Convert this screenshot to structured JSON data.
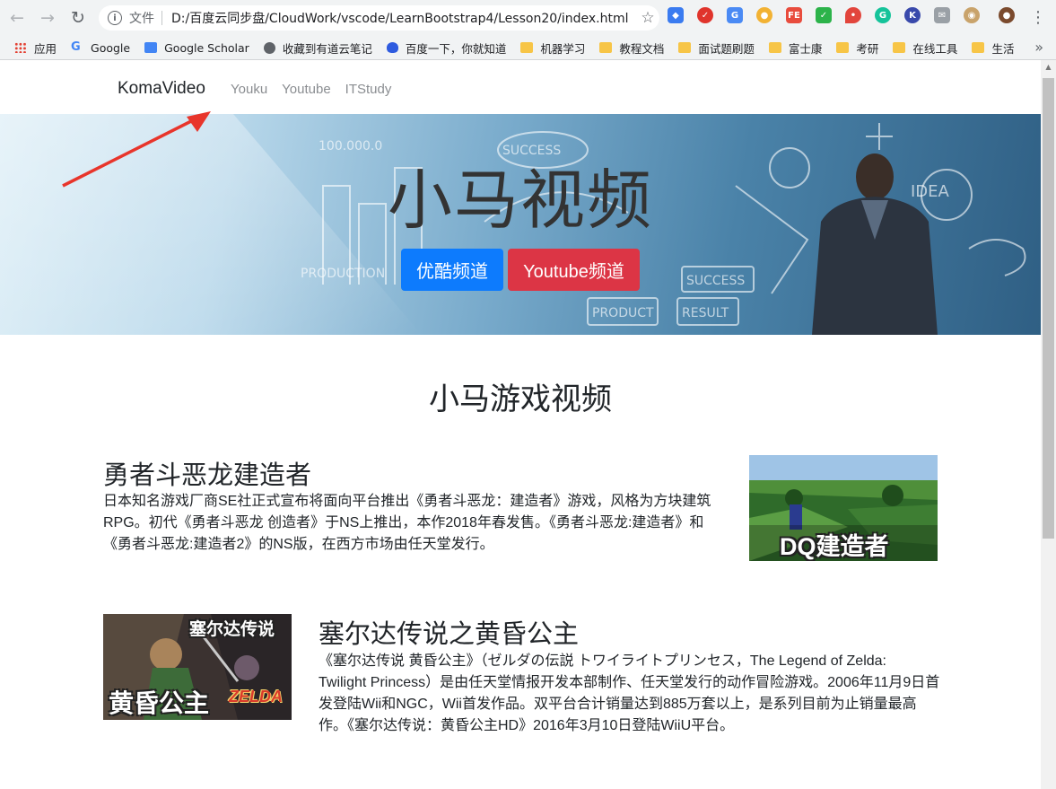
{
  "browser": {
    "url_scheme": "文件",
    "url": "D:/百度云同步盘/CloudWork/vscode/LearnBootstrap4/Lesson20/index.html",
    "bookmarks": [
      {
        "label": "应用",
        "icon": "apps-grid-icon"
      },
      {
        "label": "Google",
        "icon": "google-icon"
      },
      {
        "label": "Google Scholar",
        "icon": "scholar-icon"
      },
      {
        "label": "收藏到有道云笔记",
        "icon": "globe-icon"
      },
      {
        "label": "百度一下，你就知道",
        "icon": "baidu-paw-icon"
      },
      {
        "label": "机器学习",
        "icon": "folder-icon"
      },
      {
        "label": "教程文档",
        "icon": "folder-icon"
      },
      {
        "label": "面试题刷题",
        "icon": "folder-icon"
      },
      {
        "label": "富士康",
        "icon": "folder-icon"
      },
      {
        "label": "考研",
        "icon": "folder-icon"
      },
      {
        "label": "在线工具",
        "icon": "folder-icon"
      },
      {
        "label": "生活",
        "icon": "folder-icon"
      }
    ],
    "more_bookmarks": "»"
  },
  "page": {
    "brand": "KomaVideo",
    "nav": [
      "Youku",
      "Youtube",
      "ITStudy"
    ],
    "hero": {
      "title": "小马视频",
      "primary_button": "优酷频道",
      "danger_button": "Youtube频道"
    },
    "section_title": "小马游戏视频",
    "items": [
      {
        "title": "勇者斗恶龙建造者",
        "lines": [
          "日本知名游戏厂商SE社正式宣布将面向平台推出《勇者斗恶龙：建造者》游戏，风格为方块建筑",
          "RPG。初代《勇者斗恶龙 创造者》于NS上推出，本作2018年春发售。《勇者斗恶龙:建造者》和",
          "《勇者斗恶龙:建造者2》的NS版，在西方市场由任天堂发行。"
        ],
        "image_caption": "DQ建造者"
      },
      {
        "title": "塞尔达传说之黄昏公主",
        "lines": [
          "《塞尔达传说 黄昏公主》（ゼルダの伝説 トワイライトプリンセス，The Legend of Zelda:",
          "Twilight Princess）是由任天堂情报开发本部制作、任天堂发行的动作冒险游戏。2006年11月9日首",
          "发登陆Wii和NGC，Wii首发作品。双平台合计销量达到885万套以上，是系列目前为止销量最高",
          "作。《塞尔达传说：黄昏公主HD》2016年3月10日登陆WiiU平台。"
        ],
        "image_caption_top": "塞尔达传说",
        "image_caption_bottom": "黄昏公主",
        "image_logo": "ZELDA"
      }
    ]
  },
  "colors": {
    "primary": "#0d7bfd",
    "danger": "#dc3545",
    "annotation_arrow": "#e8352b"
  }
}
